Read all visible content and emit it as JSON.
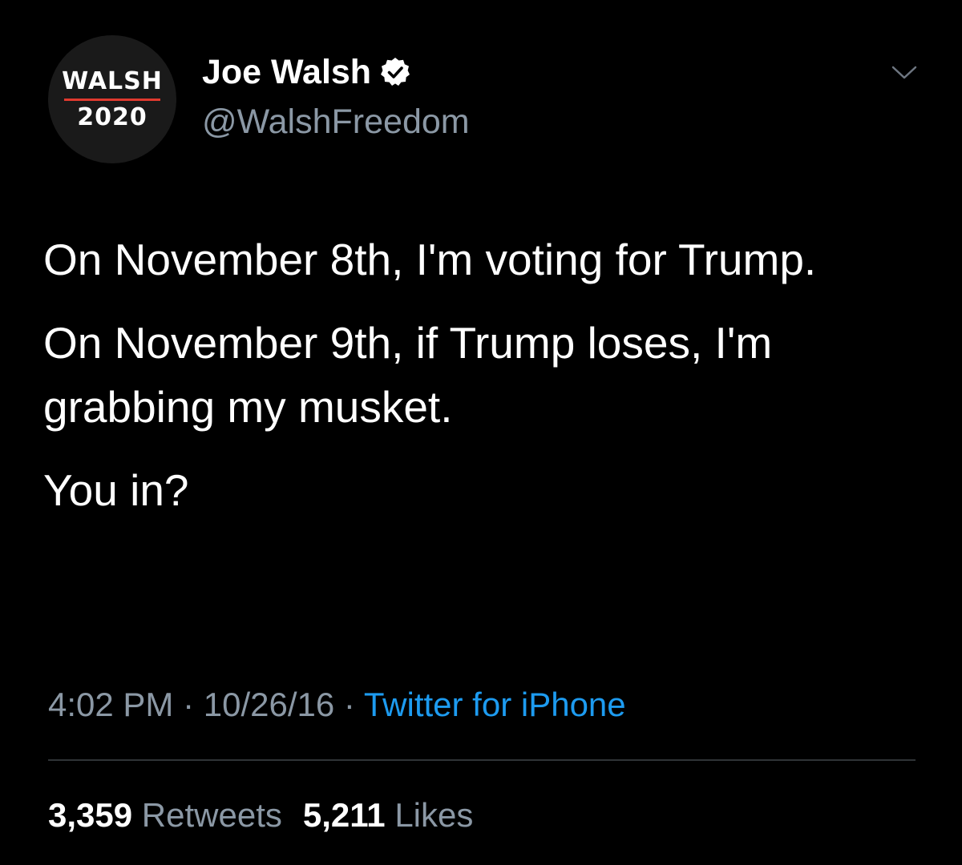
{
  "avatar": {
    "line1": "WALSH",
    "line2": "2020",
    "rule_color": "#e03a2f"
  },
  "author": {
    "display_name": "Joe Walsh",
    "handle": "@WalshFreedom",
    "verified_icon": "verified-badge-icon"
  },
  "menu_icon": "chevron-down-icon",
  "tweet": {
    "paragraphs": [
      "On November 8th, I'm voting for Trump.",
      "On November 9th, if Trump loses, I'm grabbing my musket.",
      "You in?"
    ]
  },
  "meta": {
    "time": "4:02 PM",
    "separator": " · ",
    "date": "10/26/16",
    "source": "Twitter for iPhone"
  },
  "stats": {
    "retweets_count": "3,359",
    "retweets_label": "Retweets",
    "likes_count": "5,211",
    "likes_label": "Likes"
  },
  "colors": {
    "background": "#000000",
    "text_primary": "#ffffff",
    "text_secondary": "#8b98a5",
    "link": "#1d9bf0",
    "divider": "#2f3336"
  }
}
